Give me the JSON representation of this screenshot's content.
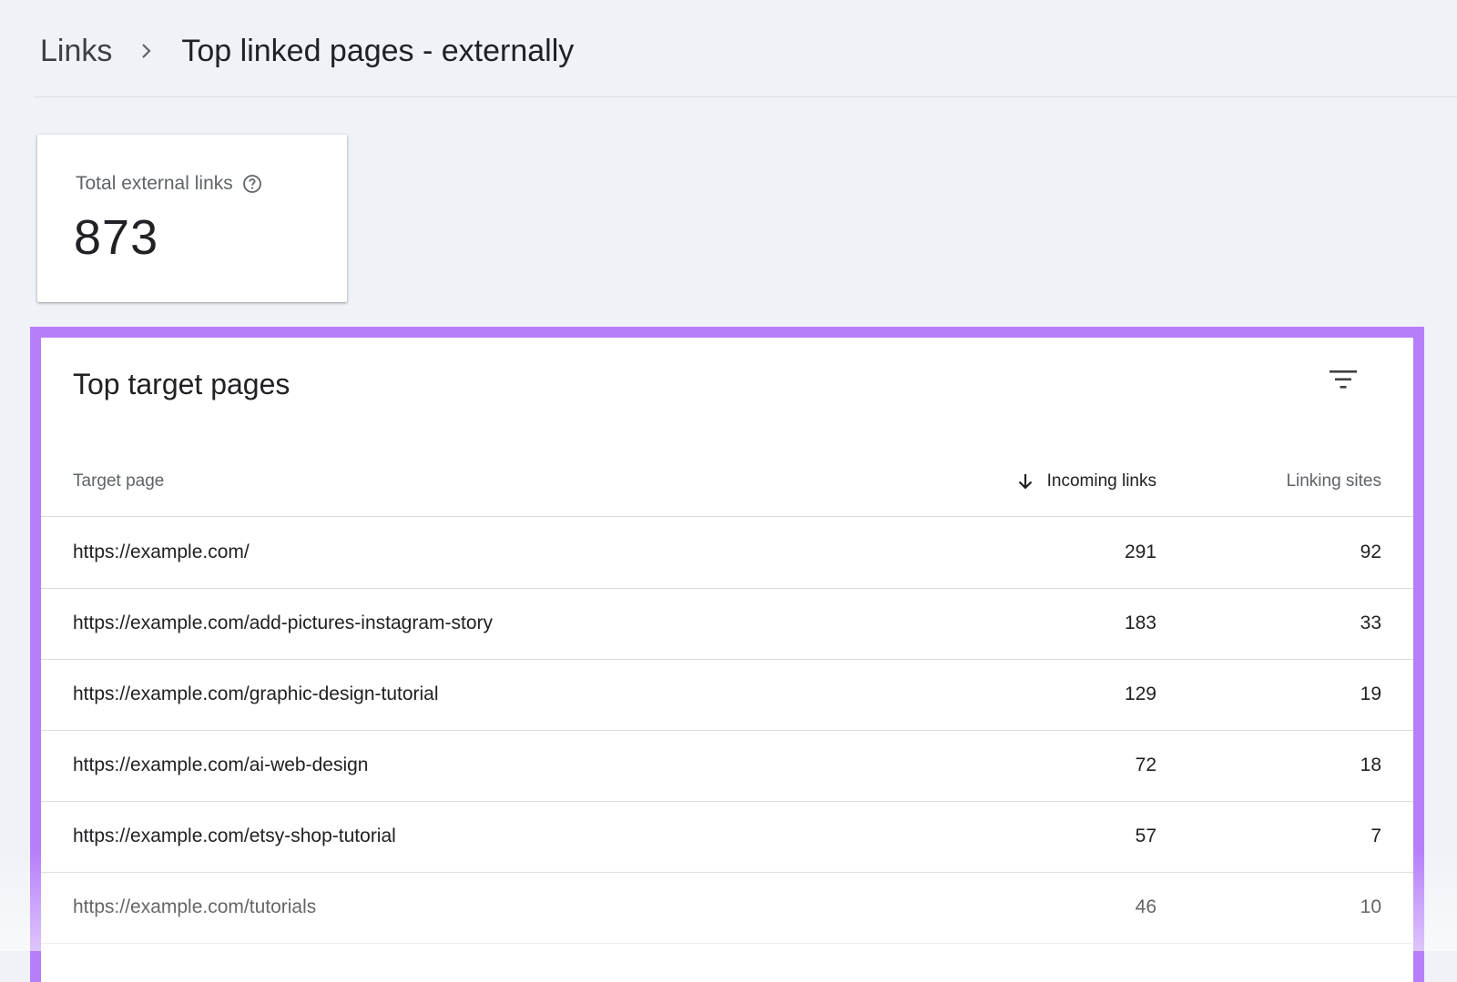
{
  "breadcrumb": {
    "root": "Links",
    "current": "Top linked pages - externally",
    "separator_icon": "chevron-right-icon"
  },
  "stat": {
    "label": "Total external links",
    "value": "873",
    "help_icon": "help-circle-icon"
  },
  "table": {
    "title": "Top target pages",
    "filter_icon": "filter-icon",
    "columns": {
      "page": "Target page",
      "incoming": "Incoming links",
      "sites": "Linking sites"
    },
    "sort_icon": "arrow-down-icon",
    "rows": [
      {
        "page": "https://example.com/",
        "incoming": "291",
        "sites": "92"
      },
      {
        "page": "https://example.com/add-pictures-instagram-story",
        "incoming": "183",
        "sites": "33"
      },
      {
        "page": "https://example.com/graphic-design-tutorial",
        "incoming": "129",
        "sites": "19"
      },
      {
        "page": "https://example.com/ai-web-design",
        "incoming": "72",
        "sites": "18"
      },
      {
        "page": "https://example.com/etsy-shop-tutorial",
        "incoming": "57",
        "sites": "7"
      },
      {
        "page": "https://example.com/tutorials",
        "incoming": "46",
        "sites": "10"
      }
    ]
  },
  "colors": {
    "highlight_border": "#b67ff9",
    "background": "#eff2f7"
  }
}
